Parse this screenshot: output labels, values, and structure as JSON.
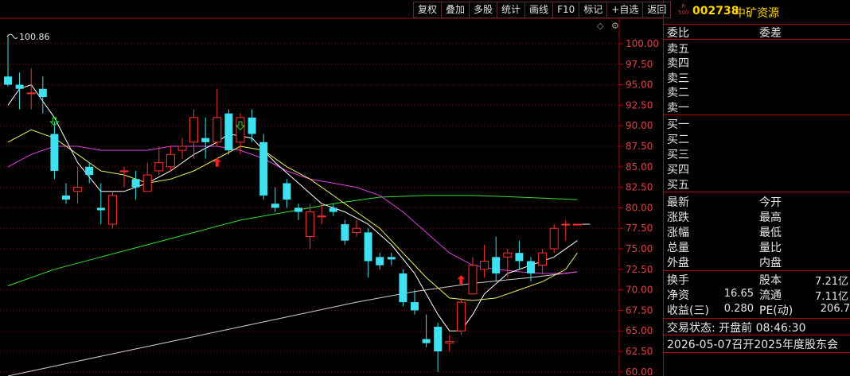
{
  "toolbar": [
    "复权",
    "叠加",
    "多股",
    "统计",
    "画线",
    "F10",
    "标记",
    "+自选",
    "返回"
  ],
  "chart_icons": {
    "diamond": "◇",
    "gear": "⚙"
  },
  "stock": {
    "badge_r": "R",
    "badge_num": "500",
    "code": "002738",
    "name": "中矿资源"
  },
  "panel": {
    "weibi": "委比",
    "weicha": "委差",
    "sell": [
      "卖五",
      "卖四",
      "卖三",
      "卖二",
      "卖一"
    ],
    "buy": [
      "买一",
      "买二",
      "买三",
      "买四",
      "买五"
    ],
    "stats_left": [
      "最新",
      "涨跌",
      "涨幅",
      "总量",
      "外盘"
    ],
    "stats_right": [
      "今开",
      "最高",
      "最低",
      "量比",
      "内盘"
    ],
    "huanshou": "换手",
    "guben": "股本",
    "guben_val": "7.21亿",
    "jingzi": "净资",
    "jingzi_val": "16.65",
    "liutong": "流通",
    "liutong_val": "7.11亿",
    "shouyi": "收益(三)",
    "shouyi_val": "0.280",
    "pe": "PE(动)",
    "pe_val": "206.7",
    "trade_state": "交易状态: 开盘前 08:46:30",
    "notice": "2026-05-07召开2025年度股东会"
  },
  "chart_data": {
    "type": "candlestick",
    "ylim": [
      59.5,
      103
    ],
    "yticks": [
      60.0,
      62.5,
      65.0,
      67.5,
      70.0,
      72.5,
      75.0,
      77.5,
      80.0,
      82.5,
      85.0,
      87.5,
      90.0,
      92.5,
      95.0,
      97.5,
      100.0
    ],
    "high_label": "100.86",
    "colors": {
      "up": "#ff3030",
      "down": "#3fe0f0",
      "ma5": "#ffffff",
      "ma10": "#f0f060",
      "ma20": "#e040e0",
      "ma60": "#30e030",
      "ma120": "#d0d0d0"
    },
    "candles": [
      [
        96.0,
        95.0,
        100.86,
        94.8
      ],
      [
        95.0,
        94.5,
        96.5,
        92.0
      ],
      [
        94.0,
        94.0,
        97.0,
        92.0
      ],
      [
        94.5,
        93.5,
        96.0,
        91.5
      ],
      [
        89.0,
        84.5,
        90.5,
        83.5
      ],
      [
        81.5,
        81.0,
        83.0,
        80.5
      ],
      [
        82.0,
        82.5,
        85.0,
        80.5
      ],
      [
        85.0,
        84.0,
        85.5,
        83.0
      ],
      [
        80.0,
        79.7,
        83.0,
        78.0
      ],
      [
        78.0,
        81.5,
        82.0,
        77.5
      ],
      [
        84.5,
        84.5,
        85.0,
        82.5
      ],
      [
        83.5,
        82.5,
        84.5,
        81.0
      ],
      [
        82.0,
        84.0,
        85.5,
        82.0
      ],
      [
        84.5,
        85.5,
        87.5,
        84.0
      ],
      [
        85.0,
        86.5,
        87.5,
        84.5
      ],
      [
        87.0,
        87.5,
        88.5,
        86.0
      ],
      [
        88.0,
        91.0,
        92.0,
        86.0
      ],
      [
        88.5,
        88.0,
        91.0,
        86.0
      ],
      [
        88.0,
        91.0,
        94.5,
        87.5
      ],
      [
        91.5,
        87.0,
        92.0,
        86.5
      ],
      [
        88.0,
        91.0,
        91.5,
        86.5
      ],
      [
        91.0,
        89.0,
        92.0,
        88.0
      ],
      [
        88.0,
        81.5,
        89.0,
        81.0
      ],
      [
        80.5,
        80.0,
        82.5,
        79.5
      ],
      [
        83.0,
        81.0,
        83.5,
        80.0
      ],
      [
        80.0,
        79.5,
        80.5,
        78.5
      ],
      [
        76.5,
        79.5,
        80.5,
        75.0
      ],
      [
        79.0,
        79.0,
        80.5,
        78.0
      ],
      [
        80.0,
        79.5,
        80.5,
        79.0
      ],
      [
        78.0,
        76.0,
        78.5,
        75.5
      ],
      [
        77.0,
        77.5,
        78.5,
        76.5
      ],
      [
        77.0,
        73.5,
        77.5,
        71.5
      ],
      [
        74.0,
        73.0,
        74.5,
        72.5
      ],
      [
        74.0,
        73.7,
        74.5,
        73.0
      ],
      [
        72.0,
        68.5,
        72.5,
        68.0
      ],
      [
        68.5,
        67.5,
        70.0,
        67.0
      ],
      [
        64.0,
        63.5,
        67.0,
        63.0
      ],
      [
        65.5,
        62.5,
        66.0,
        60.0
      ],
      [
        63.5,
        63.7,
        64.5,
        62.5
      ],
      [
        65.0,
        68.5,
        69.0,
        64.5
      ],
      [
        69.5,
        73.0,
        74.0,
        69.5
      ],
      [
        72.5,
        73.5,
        75.5,
        71.5
      ],
      [
        74.0,
        72.0,
        76.5,
        71.0
      ],
      [
        74.0,
        74.5,
        75.0,
        71.5
      ],
      [
        74.5,
        73.5,
        76.0,
        72.5
      ],
      [
        73.5,
        72.0,
        74.0,
        71.0
      ],
      [
        73.0,
        74.5,
        75.0,
        72.0
      ],
      [
        75.0,
        77.5,
        78.0,
        74.5
      ],
      [
        78.0,
        78.0,
        78.5,
        76.0
      ],
      [
        78.0,
        78.0,
        78.0,
        78.0
      ]
    ],
    "ma5": [
      [
        0,
        92.5
      ],
      [
        1,
        94.5
      ],
      [
        2,
        95.0
      ],
      [
        4,
        91.0
      ],
      [
        6,
        85.5
      ],
      [
        8,
        82.0
      ],
      [
        10,
        82.0
      ],
      [
        12,
        83.0
      ],
      [
        14,
        84.5
      ],
      [
        16,
        86.5
      ],
      [
        18,
        88.0
      ],
      [
        19,
        89.0
      ],
      [
        21,
        88.5
      ],
      [
        23,
        85.5
      ],
      [
        25,
        83.0
      ],
      [
        27,
        80.5
      ],
      [
        29,
        79.5
      ],
      [
        31,
        78.0
      ],
      [
        33,
        75.5
      ],
      [
        35,
        72.0
      ],
      [
        37,
        67.0
      ],
      [
        38,
        65.0
      ],
      [
        39,
        65.0
      ],
      [
        40,
        67.0
      ],
      [
        41,
        69.5
      ],
      [
        43,
        72.0
      ],
      [
        45,
        73.0
      ],
      [
        47,
        74.0
      ],
      [
        49,
        76.0
      ]
    ],
    "ma10": [
      [
        0,
        88.0
      ],
      [
        2,
        89.5
      ],
      [
        4,
        88.5
      ],
      [
        6,
        86.5
      ],
      [
        8,
        84.5
      ],
      [
        10,
        84.0
      ],
      [
        12,
        83.0
      ],
      [
        14,
        83.5
      ],
      [
        16,
        84.5
      ],
      [
        18,
        86.0
      ],
      [
        20,
        87.5
      ],
      [
        22,
        87.0
      ],
      [
        24,
        85.0
      ],
      [
        26,
        83.5
      ],
      [
        28,
        81.5
      ],
      [
        30,
        79.5
      ],
      [
        32,
        77.5
      ],
      [
        34,
        74.5
      ],
      [
        36,
        71.5
      ],
      [
        38,
        69.0
      ],
      [
        40,
        68.7
      ],
      [
        42,
        69.0
      ],
      [
        44,
        70.0
      ],
      [
        46,
        71.0
      ],
      [
        48,
        72.5
      ],
      [
        49,
        74.5
      ]
    ],
    "ma20": [
      [
        0,
        85.0
      ],
      [
        2,
        86.5
      ],
      [
        4,
        87.5
      ],
      [
        6,
        87.5
      ],
      [
        8,
        87.0
      ],
      [
        10,
        87.0
      ],
      [
        12,
        87.0
      ],
      [
        14,
        87.5
      ],
      [
        16,
        87.5
      ],
      [
        18,
        87.5
      ],
      [
        20,
        87.0
      ],
      [
        22,
        86.0
      ],
      [
        24,
        84.5
      ],
      [
        26,
        83.5
      ],
      [
        28,
        83.0
      ],
      [
        30,
        82.5
      ],
      [
        32,
        81.5
      ],
      [
        34,
        79.5
      ],
      [
        36,
        77.0
      ],
      [
        38,
        74.5
      ],
      [
        40,
        73.0
      ],
      [
        42,
        72.5
      ],
      [
        44,
        72.2
      ],
      [
        46,
        72.0
      ],
      [
        48,
        72.0
      ],
      [
        49,
        72.2
      ]
    ],
    "ma60": [
      [
        0,
        70.5
      ],
      [
        4,
        72.5
      ],
      [
        8,
        74.0
      ],
      [
        12,
        75.5
      ],
      [
        16,
        77.0
      ],
      [
        20,
        78.5
      ],
      [
        24,
        79.5
      ],
      [
        28,
        80.5
      ],
      [
        32,
        81.3
      ],
      [
        36,
        81.5
      ],
      [
        40,
        81.5
      ],
      [
        44,
        81.3
      ],
      [
        49,
        81.0
      ]
    ],
    "ma120": [
      [
        0,
        59.5
      ],
      [
        5,
        61.0
      ],
      [
        10,
        62.5
      ],
      [
        15,
        64.0
      ],
      [
        20,
        65.5
      ],
      [
        25,
        67.0
      ],
      [
        30,
        68.5
      ],
      [
        35,
        69.8
      ],
      [
        40,
        70.8
      ],
      [
        45,
        71.5
      ],
      [
        49,
        72.2
      ]
    ],
    "arrows_up": [
      [
        18,
        85.5
      ],
      [
        39,
        71.2
      ]
    ],
    "arrows_down": [
      [
        4,
        90.5
      ],
      [
        20,
        90.0
      ]
    ]
  }
}
